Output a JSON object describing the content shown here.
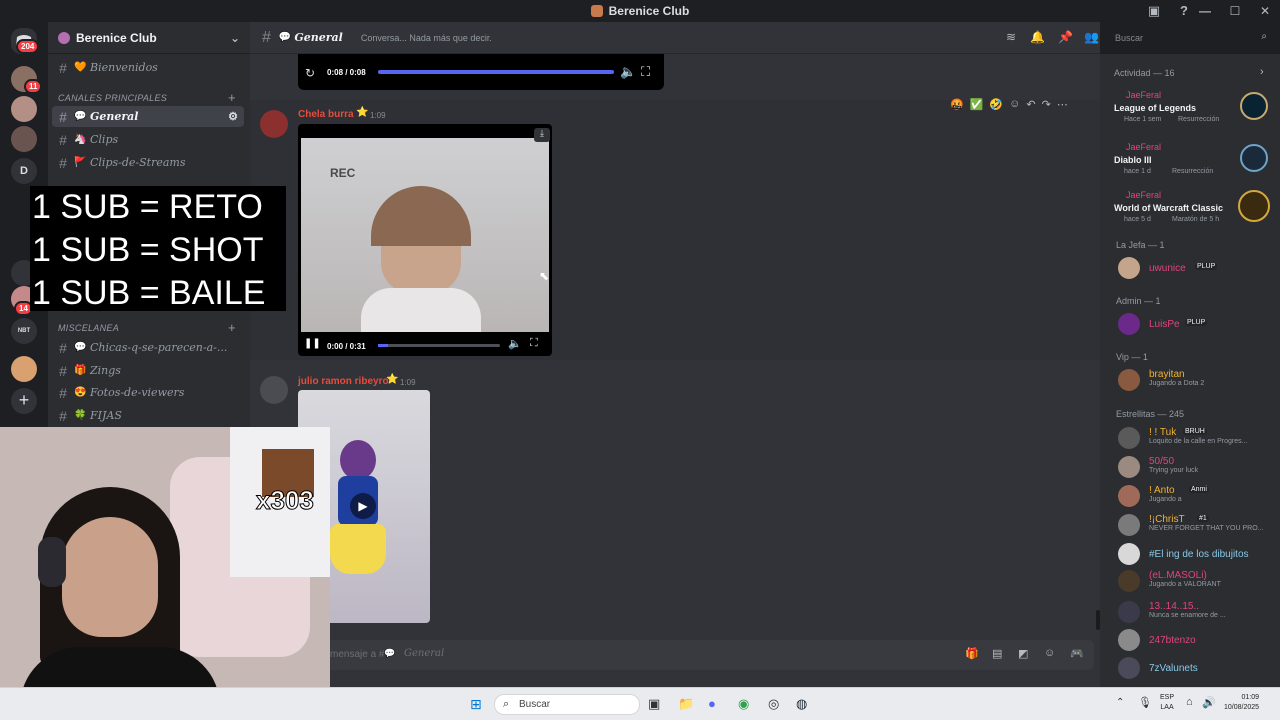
{
  "window": {
    "title": "Berenice Club"
  },
  "rail": {
    "dm_badge": "204",
    "badges": [
      "11",
      "14"
    ],
    "letter": "D",
    "label_nbt": "NBT"
  },
  "server": {
    "name": "Berenice Club"
  },
  "channels": {
    "top": {
      "name": "Bienvenidos",
      "emoji": "🧡"
    },
    "category_main": "Canales principales",
    "main": [
      {
        "name": "General",
        "emoji": "💬"
      },
      {
        "name": "Clips",
        "emoji": "🦄"
      },
      {
        "name": "Clips-de-Streams",
        "emoji": "🚩"
      }
    ],
    "category_misc": "Miscelanea",
    "misc": [
      {
        "name": "Chicas-q-se-parecen-a-...",
        "emoji": "💬"
      },
      {
        "name": "Zings",
        "emoji": "🎁"
      },
      {
        "name": "Fotos-de-viewers",
        "emoji": "😍"
      },
      {
        "name": "FIJAS",
        "emoji": "🍀"
      }
    ]
  },
  "header": {
    "channel": "General",
    "topic": "Conversa... Nada más que decir."
  },
  "search": {
    "placeholder": "Buscar"
  },
  "chat": {
    "audio_time": "0:08 / 0:08",
    "msg1": {
      "author": "Chela burra",
      "time": "1:09",
      "video_label": "REC",
      "video_time": "0:00 / 0:31"
    },
    "msg2": {
      "author": "julio ramon ribeyro",
      "time": "1:09"
    },
    "composer_placeholder": "mensaje a #",
    "composer_channel": "General"
  },
  "overlay": {
    "lines": [
      "1 SUB = RETO",
      "1 SUB = SHOT",
      "1 SUB = BAILE"
    ],
    "meme_counter": "x303"
  },
  "activity": {
    "header": "Actividad — 16",
    "cards": [
      {
        "user": "JaeFeral",
        "game": "League of Legends",
        "meta": "Hace 1 sem",
        "extra": "Resurrección"
      },
      {
        "user": "JaeFeral",
        "game": "Diablo III",
        "meta": "hace 1 d",
        "extra": "Resurrección"
      },
      {
        "user": "JaeFeral",
        "game": "World of Warcraft Classic",
        "meta": "hace 5 d",
        "extra": "Maratón de 5 h"
      }
    ]
  },
  "members": {
    "sections": [
      {
        "label": "La Jefa — 1"
      },
      {
        "label": "Admin — 1"
      },
      {
        "label": "Vip — 1"
      },
      {
        "label": "Estrellitas — 245"
      }
    ],
    "list": [
      {
        "name": "uwunice",
        "tag": "PLUP",
        "status": "",
        "color": "#e3437f"
      },
      {
        "name": "LuisPe",
        "tag": "PLUP",
        "status": "",
        "color": "#e3437f"
      },
      {
        "name": "brayitan",
        "tag": "",
        "status": "Jugando a Dota 2",
        "color": "#f0b232"
      },
      {
        "name": "! ! Tuk",
        "tag": "BRUH",
        "status": "Loquito de la calle en Progres...",
        "color": "#f0b232"
      },
      {
        "name": "50/50",
        "tag": "",
        "status": "Trying your luck",
        "color": "#e3437f"
      },
      {
        "name": "! Anto",
        "tag": "Anmi",
        "status": "Jugando a",
        "color": "#f0b232"
      },
      {
        "name": "!¡ChrisT",
        "tag": "#1",
        "status": "NEVER FORGET THAT YOU PRO...",
        "color": "#f0b232"
      },
      {
        "name": "#El ing de los dibujitos",
        "tag": "",
        "status": "",
        "color": "#88c9e8"
      },
      {
        "name": "(eL.MASOLi)",
        "tag": "",
        "status": "Jugando a VALORANT",
        "color": "#e3437f"
      },
      {
        "name": "13..14..15..",
        "tag": "",
        "status": "Nunca se enamore de ...",
        "color": "#e3437f"
      },
      {
        "name": "247btenzo",
        "tag": "",
        "status": "",
        "color": "#e3437f"
      },
      {
        "name": "7zValunets",
        "tag": "",
        "status": "",
        "color": "#88c9e8"
      }
    ]
  },
  "taskbar": {
    "search": "Buscar",
    "lang": "ESP",
    "region": "LAA",
    "time": "01:09",
    "date": "10/08/2025"
  },
  "colors": {
    "accent": "#5865f2",
    "danger": "#f23f43",
    "online": "#23a55a"
  }
}
